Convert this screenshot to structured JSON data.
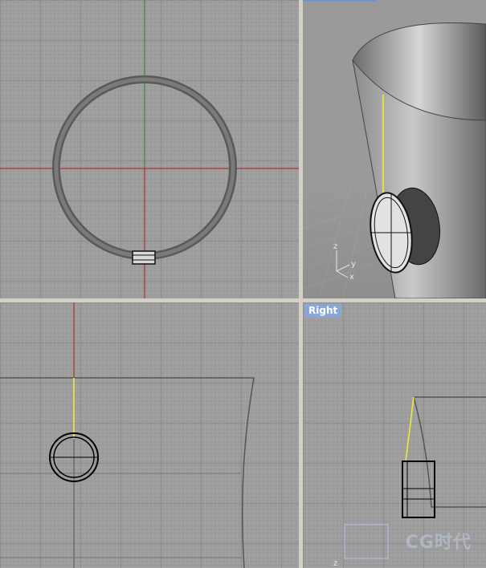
{
  "viewports": {
    "top": {
      "label": ""
    },
    "perspective": {
      "label": ""
    },
    "front": {
      "label": ""
    },
    "right": {
      "label": "Right"
    }
  },
  "axis_labels": {
    "z": "z",
    "y": "y",
    "x": "x"
  },
  "watermark": {
    "text": "CG时代"
  },
  "colors": {
    "viewport_bg": "#9b9b9b",
    "x_axis": "#b01818",
    "y_axis": "#1a8a1a",
    "selection_line": "#f2ee2a",
    "label_bg": "#8aa6d6"
  }
}
